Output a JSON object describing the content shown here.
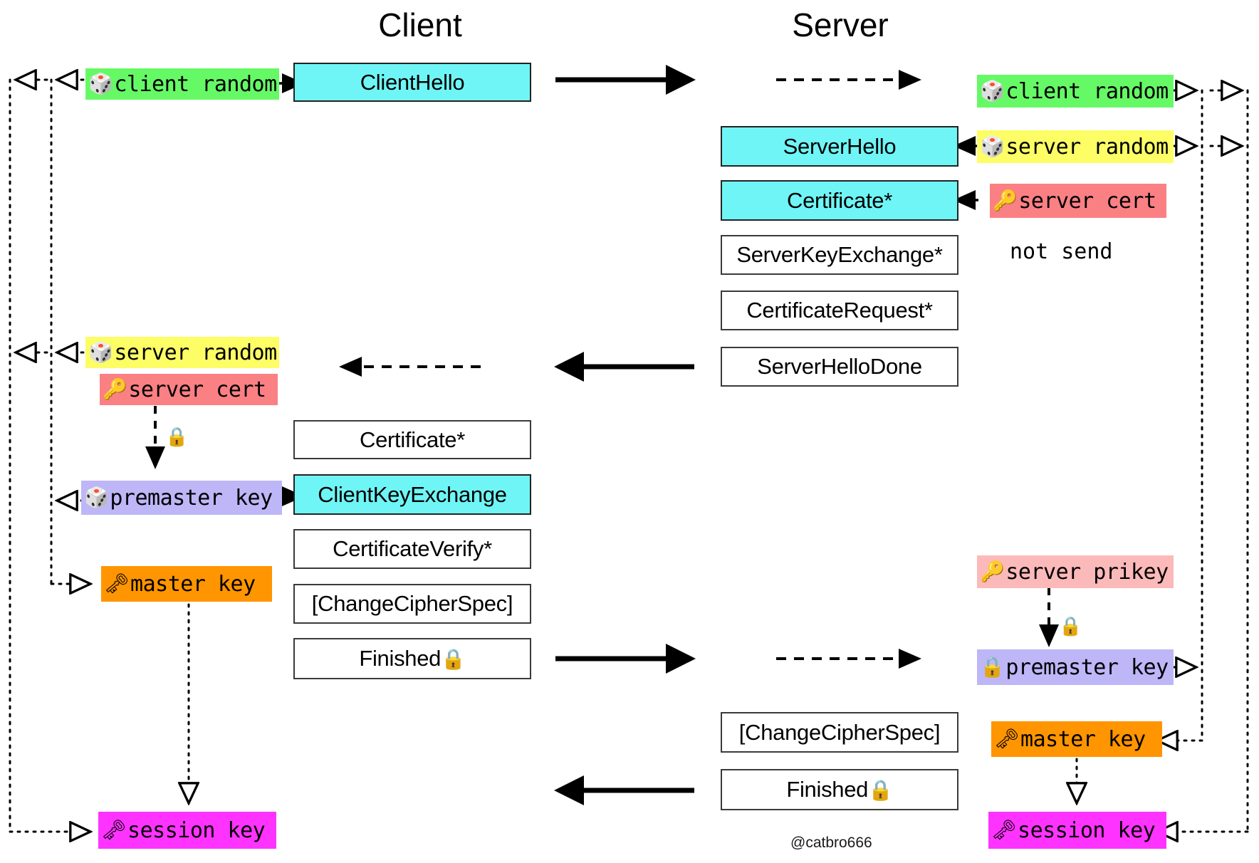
{
  "diagram": {
    "title_client": "Client",
    "title_server": "Server",
    "credit": "@catbro666",
    "note_not_send": "not send",
    "colors": {
      "cyan_msg": "#6ff5f5",
      "white_msg": "#ffffff",
      "client_random": "#66f966",
      "server_random": "#fdfd66",
      "server_cert": "#fa8084",
      "server_prikey": "#fcb9ba",
      "premaster_key": "#bdb6f7",
      "master_key": "#ff9500",
      "session_key": "#ff33ff",
      "border": "#3a3a3a"
    }
  },
  "client": {
    "messages": [
      {
        "label": "ClientHello",
        "style": "cyan"
      },
      {
        "label": "Certificate*",
        "style": "white"
      },
      {
        "label": "ClientKeyExchange",
        "style": "cyan"
      },
      {
        "label": "CertificateVerify*",
        "style": "white"
      },
      {
        "label": "[ChangeCipherSpec]",
        "style": "white"
      },
      {
        "label": "Finished",
        "style": "white",
        "lock": "🔒"
      }
    ],
    "chips": [
      {
        "glyph": "🎲",
        "label": "client random",
        "color": "#66f966"
      },
      {
        "glyph": "🎲",
        "label": "server random",
        "color": "#fdfd66"
      },
      {
        "glyph": "🔑",
        "label": "server cert",
        "color": "#fa8084"
      },
      {
        "glyph": "🎲",
        "label": "premaster key",
        "color": "#bdb6f7"
      },
      {
        "glyph": "🗝",
        "label": "master key",
        "color": "#ff9500"
      },
      {
        "glyph": "🗝",
        "label": "session key",
        "color": "#ff33ff"
      }
    ]
  },
  "server": {
    "messages": [
      {
        "label": "ServerHello",
        "style": "cyan"
      },
      {
        "label": "Certificate*",
        "style": "cyan"
      },
      {
        "label": "ServerKeyExchange*",
        "style": "white"
      },
      {
        "label": "CertificateRequest*",
        "style": "white"
      },
      {
        "label": "ServerHelloDone",
        "style": "white"
      },
      {
        "label": "[ChangeCipherSpec]",
        "style": "white"
      },
      {
        "label": "Finished",
        "style": "white",
        "lock": "🔒"
      }
    ],
    "chips": [
      {
        "glyph": "🎲",
        "label": "client random",
        "color": "#66f966"
      },
      {
        "glyph": "🎲",
        "label": "server random",
        "color": "#fdfd66"
      },
      {
        "glyph": "🔑",
        "label": "server cert",
        "color": "#fa8084"
      },
      {
        "glyph": "🔑",
        "label": "server prikey",
        "color": "#fcb9ba"
      },
      {
        "glyph": "🔒",
        "label": "premaster key",
        "color": "#bdb6f7"
      },
      {
        "glyph": "🗝",
        "label": "master key",
        "color": "#ff9500"
      },
      {
        "glyph": "🗝",
        "label": "session key",
        "color": "#ff33ff"
      }
    ]
  },
  "locks": {
    "client_encrypt": "🔒",
    "server_decrypt": "🔒"
  }
}
